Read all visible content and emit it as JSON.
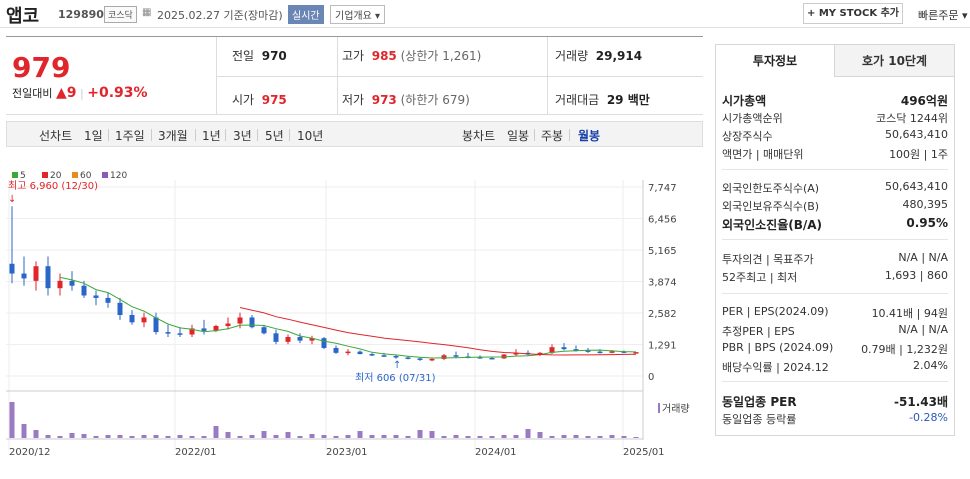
{
  "header": {
    "stock_name": "앱코",
    "stock_code": "129890",
    "market": "코스닥",
    "date_text": "2025.02.27  기준(장마감)",
    "realtime": "실시간",
    "overview": "기업개요 ▾",
    "my_stock": "+ MY STOCK 추가",
    "quick_order": "빠른주문 ▾"
  },
  "price": {
    "current": "979",
    "diff_label": "전일대비",
    "diff_arrow": "▲",
    "diff_value": "9",
    "diff_pct": "+0.93%",
    "prev_label": "전일",
    "prev": "970",
    "high_label": "고가",
    "high": "985",
    "upper_limit": "(상한가 1,261)",
    "volume_label": "거래량",
    "volume": "29,914",
    "open_label": "시가",
    "open": "975",
    "low_label": "저가",
    "low": "973",
    "lower_limit": "(하한가 679)",
    "amount_label": "거래대금",
    "amount": "29 백만"
  },
  "toolbar": {
    "line_chart": "선차트",
    "periods": [
      "1일",
      "1주일",
      "3개월",
      "1년",
      "3년",
      "5년",
      "10년"
    ],
    "candle_chart": "봉차트",
    "candles": [
      "일봉",
      "주봉",
      "월봉"
    ],
    "selected_candle": "월봉"
  },
  "chart_data": {
    "type": "candlestick",
    "legend": [
      "5",
      "20",
      "60",
      "120"
    ],
    "legend_colors": [
      "#3aa83a",
      "#e0252b",
      "#e88a1c",
      "#8a5ab8"
    ],
    "y_ticks": [
      "7,747",
      "6,456",
      "5,165",
      "3,874",
      "2,582",
      "1,291",
      "0"
    ],
    "x_ticks": [
      "2020/12",
      "2022/01",
      "2023/01",
      "2024/01",
      "2025/01"
    ],
    "high_annotation": "최고 6,960 (12/30)",
    "low_annotation": "최저 606 (07/31)",
    "volume_label": "거래량",
    "up_color": "#e0252b",
    "down_color": "#2a66c8"
  },
  "invest": {
    "tab_on": "투자정보",
    "tab_off": "호가 10단계",
    "rows": [
      {
        "k": "시가총액",
        "v": "496억원",
        "bold": true
      },
      {
        "k": "시가총액순위",
        "v": "코스닥 1244위"
      },
      {
        "k": "상장주식수",
        "v": "50,643,410"
      },
      {
        "k": "액면가 | 매매단위",
        "v": "100원 | 1주"
      },
      {
        "k": "외국인한도주식수(A)",
        "v": "50,643,410"
      },
      {
        "k": "외국인보유주식수(B)",
        "v": "480,395"
      },
      {
        "k": "외국인소진율(B/A)",
        "v": "0.95%",
        "bold": true
      },
      {
        "k": "투자의견 | 목표주가",
        "v": "N/A | N/A"
      },
      {
        "k": "52주최고 | 최저",
        "v": "1,693 | 860"
      },
      {
        "k": "PER | EPS(2024.09)",
        "v": "10.41배 | 94원"
      },
      {
        "k": "추정PER | EPS",
        "v": "N/A | N/A"
      },
      {
        "k": "PBR | BPS (2024.09)",
        "v": "0.79배 | 1,232원"
      },
      {
        "k": "배당수익률 | 2024.12",
        "v": "2.04%"
      },
      {
        "k": "동일업종 PER",
        "v": "-51.43배",
        "bold": true
      },
      {
        "k": "동일업종 등락률",
        "v": "-0.28%",
        "blue": true
      }
    ]
  }
}
